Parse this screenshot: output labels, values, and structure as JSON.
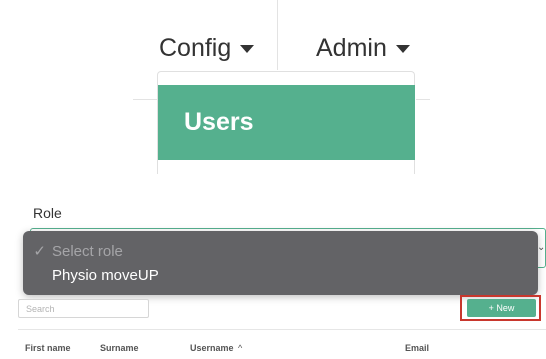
{
  "nav": {
    "config_label": "Config",
    "admin_label": "Admin",
    "config_menu": {
      "items": [
        {
          "label": "Users",
          "active": true
        }
      ]
    }
  },
  "role": {
    "label": "Role",
    "options": [
      {
        "label": "Select role",
        "selected": true,
        "check": "✓"
      },
      {
        "label": "Physio moveUP",
        "selected": false
      }
    ]
  },
  "toolbar": {
    "search_placeholder": "Search",
    "new_button_label": "+ New"
  },
  "table": {
    "columns": [
      {
        "label": "First name"
      },
      {
        "label": "Surname"
      },
      {
        "label": "Username",
        "sort": "^"
      },
      {
        "label": "Email"
      }
    ]
  },
  "colors": {
    "accent": "#55b08e",
    "highlight": "#c8372d",
    "popup_bg": "#636366"
  },
  "icons": [
    "caret-down-icon",
    "checkmark-icon",
    "sort-up-icon",
    "chevron-down-icon"
  ]
}
